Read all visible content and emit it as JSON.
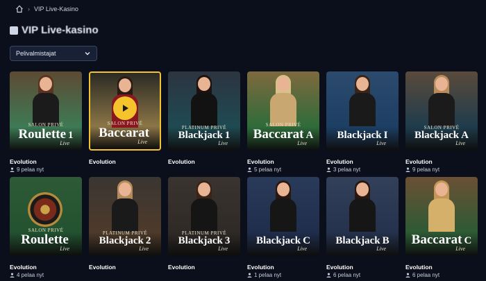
{
  "breadcrumb": {
    "label": "VIP Live-Kasino"
  },
  "page": {
    "title": "VIP Live-kasino"
  },
  "filter": {
    "label": "Pelivalmistajat"
  },
  "games": [
    {
      "title_small": "SALON PRIVÉ",
      "title_big": "Roulette",
      "suffix": "1",
      "live": "Live",
      "provider": "Evolution",
      "players": "9 pelaa nyt",
      "bg": "#5d4a33",
      "accent": "#3e7a55",
      "hair": "#5a3420",
      "dress": "#1b1b1b",
      "selected": false
    },
    {
      "title_small": "SALON PRIVÉ",
      "title_big": "Baccarat",
      "suffix": "",
      "live": "Live",
      "provider": "Evolution",
      "players": "",
      "bg": "#2b2a24",
      "accent": "#8a7546",
      "hair": "#2a1a12",
      "dress": "#8a1620",
      "selected": true
    },
    {
      "title_small": "PLATINUM PRIVÉ",
      "title_big": "Blackjack",
      "suffix": "1",
      "live": "Live",
      "provider": "Evolution",
      "players": "",
      "bg": "#2c3440",
      "accent": "#1f4a52",
      "hair": "#1d1210",
      "dress": "#121212",
      "selected": false
    },
    {
      "title_small": "SALON PRIVÉ",
      "title_big": "Baccarat",
      "suffix": "A",
      "live": "Live",
      "provider": "Evolution",
      "players": "5 pelaa nyt",
      "bg": "#7e6a3e",
      "accent": "#2f6b3a",
      "hair": "#d9c08a",
      "dress": "#c8a770",
      "selected": false
    },
    {
      "title_small": "",
      "title_big": "Blackjack",
      "suffix": "I",
      "live": "Live",
      "provider": "Evolution",
      "players": "3 pelaa nyt",
      "bg": "#2b4a6e",
      "accent": "#1d3f63",
      "hair": "#3a2418",
      "dress": "#1a1a1a",
      "selected": false
    },
    {
      "title_small": "SALON PRIVÉ",
      "title_big": "Blackjack",
      "suffix": "A",
      "live": "Live",
      "provider": "Evolution",
      "players": "9 pelaa nyt",
      "bg": "#5a4a3c",
      "accent": "#1f3c4c",
      "hair": "#b88c5a",
      "dress": "#1b1b1b",
      "selected": false
    },
    {
      "title_small": "SALON PRIVÉ",
      "title_big": "Roulette",
      "suffix": "",
      "live": "Live",
      "provider": "Evolution",
      "players": "4 pelaa nyt",
      "bg": "#2e5a36",
      "accent": "#235230",
      "hair": "",
      "dress": "",
      "selected": false
    },
    {
      "title_small": "PLATINUM PRIVÉ",
      "title_big": "Blackjack",
      "suffix": "2",
      "live": "Live",
      "provider": "Evolution",
      "players": "",
      "bg": "#3a3632",
      "accent": "#4d3a2a",
      "hair": "#b38a5c",
      "dress": "#1a1a1a",
      "selected": false
    },
    {
      "title_small": "PLATINUM PRIVÉ",
      "title_big": "Blackjack",
      "suffix": "3",
      "live": "Live",
      "provider": "Evolution",
      "players": "",
      "bg": "#3a3430",
      "accent": "#2f2a26",
      "hair": "#3a2418",
      "dress": "#151515",
      "selected": false
    },
    {
      "title_small": "",
      "title_big": "Blackjack",
      "suffix": "C",
      "live": "Live",
      "provider": "Evolution",
      "players": "1 pelaa nyt",
      "bg": "#2a3a5a",
      "accent": "#1f2e4c",
      "hair": "#2a1810",
      "dress": "#161616",
      "selected": false
    },
    {
      "title_small": "",
      "title_big": "Blackjack",
      "suffix": "B",
      "live": "Live",
      "provider": "Evolution",
      "players": "6 pelaa nyt",
      "bg": "#33405a",
      "accent": "#25324d",
      "hair": "#2a1810",
      "dress": "#161616",
      "selected": false
    },
    {
      "title_small": "",
      "title_big": "Baccarat",
      "suffix": "C",
      "live": "Live",
      "provider": "Evolution",
      "players": "6 pelaa nyt",
      "bg": "#6b5034",
      "accent": "#2d5a34",
      "hair": "#c49556",
      "dress": "#d4b06a",
      "selected": false
    }
  ],
  "colors": {
    "background": "#0b0f1c",
    "highlight": "#f5c32c"
  }
}
